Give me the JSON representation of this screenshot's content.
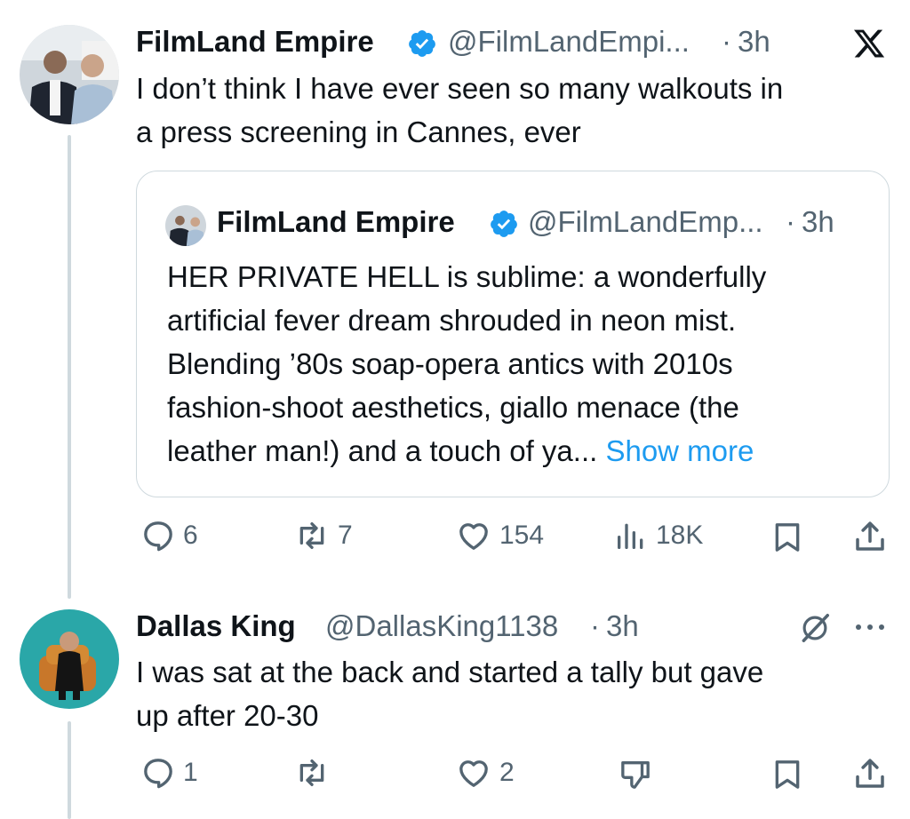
{
  "tweet1": {
    "name": "FilmLand Empire",
    "handle": "@FilmLandEmpi...",
    "dot": "·",
    "time": "3h",
    "text_line1": "I don’t think I have ever seen so many walkouts in",
    "text_line2": "a press screening in Cannes, ever",
    "quote": {
      "name": "FilmLand Empire",
      "handle": "@FilmLandEmp...",
      "dot": "·",
      "time": "3h",
      "lines": [
        "HER PRIVATE HELL is sublime: a wonderfully",
        "artificial fever dream shrouded in neon mist.",
        "Blending ’80s soap-opera antics with 2010s",
        "fashion-shoot aesthetics, giallo menace (the",
        "leather man!) and a touch of ya..."
      ],
      "show_more": "Show more"
    },
    "actions": {
      "replies": "6",
      "reposts": "7",
      "likes": "154",
      "views": "18K"
    }
  },
  "tweet2": {
    "name": "Dallas King",
    "handle": "@DallasKing1138",
    "dot": "·",
    "time": "3h",
    "text_line1": "I was sat at the back and started a tally but gave",
    "text_line2": "up after 20-30",
    "actions": {
      "replies": "1",
      "reposts": "",
      "likes": "2"
    }
  },
  "colors": {
    "verified": "#1d9bf0",
    "link": "#1d9bf0",
    "secondary_text": "#536471",
    "thread_line": "#cfd9de"
  },
  "icons": [
    "x-logo-icon",
    "verified-badge-icon",
    "reply-icon",
    "repost-icon",
    "like-icon",
    "views-icon",
    "bookmark-icon",
    "share-icon",
    "grok-icon",
    "more-icon",
    "dislike-icon"
  ]
}
